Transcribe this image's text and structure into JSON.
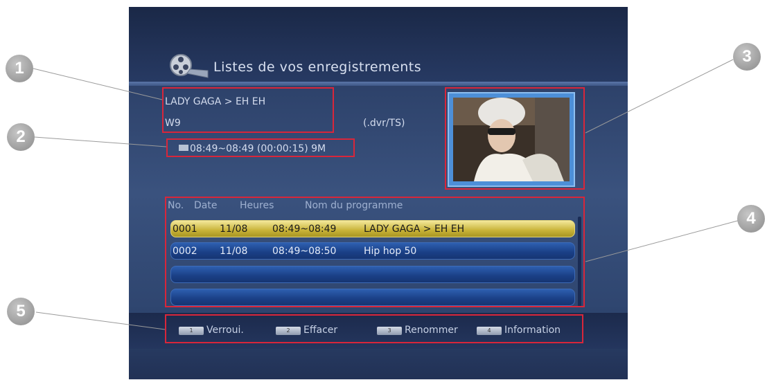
{
  "screen": {
    "title": "Listes de vos enregistrements",
    "title_icon": "film-reel-icon"
  },
  "selected_recording": {
    "name": "LADY GAGA > EH EH",
    "channel": "W9",
    "format": "(.dvr/TS)",
    "time_info": "08:49~08:49 (00:00:15) 9M",
    "time_icon": "recording-icon"
  },
  "list": {
    "headers": {
      "no": "No.",
      "date": "Date",
      "hours": "Heures",
      "name": "Nom du programme"
    },
    "rows": [
      {
        "no": "0001",
        "date": "11/08",
        "hours": "08:49~08:49",
        "name": "LADY GAGA > EH EH",
        "selected": true
      },
      {
        "no": "0002",
        "date": "11/08",
        "hours": "08:49~08:50",
        "name": "Hip hop 50",
        "selected": false
      },
      {
        "no": "",
        "date": "",
        "hours": "",
        "name": "",
        "selected": false
      },
      {
        "no": "",
        "date": "",
        "hours": "",
        "name": "",
        "selected": false
      }
    ]
  },
  "footer": {
    "keys": [
      {
        "key": "1",
        "label": "Verroui."
      },
      {
        "key": "2",
        "label": "Effacer"
      },
      {
        "key": "3",
        "label": "Renommer"
      },
      {
        "key": "4",
        "label": "Information"
      }
    ]
  },
  "callouts": [
    "1",
    "2",
    "3",
    "4",
    "5"
  ],
  "colors": {
    "highlight": "#d9263a",
    "selected_row": "#c9b338",
    "normal_row": "#1a3f85",
    "background": "#2c4068"
  }
}
